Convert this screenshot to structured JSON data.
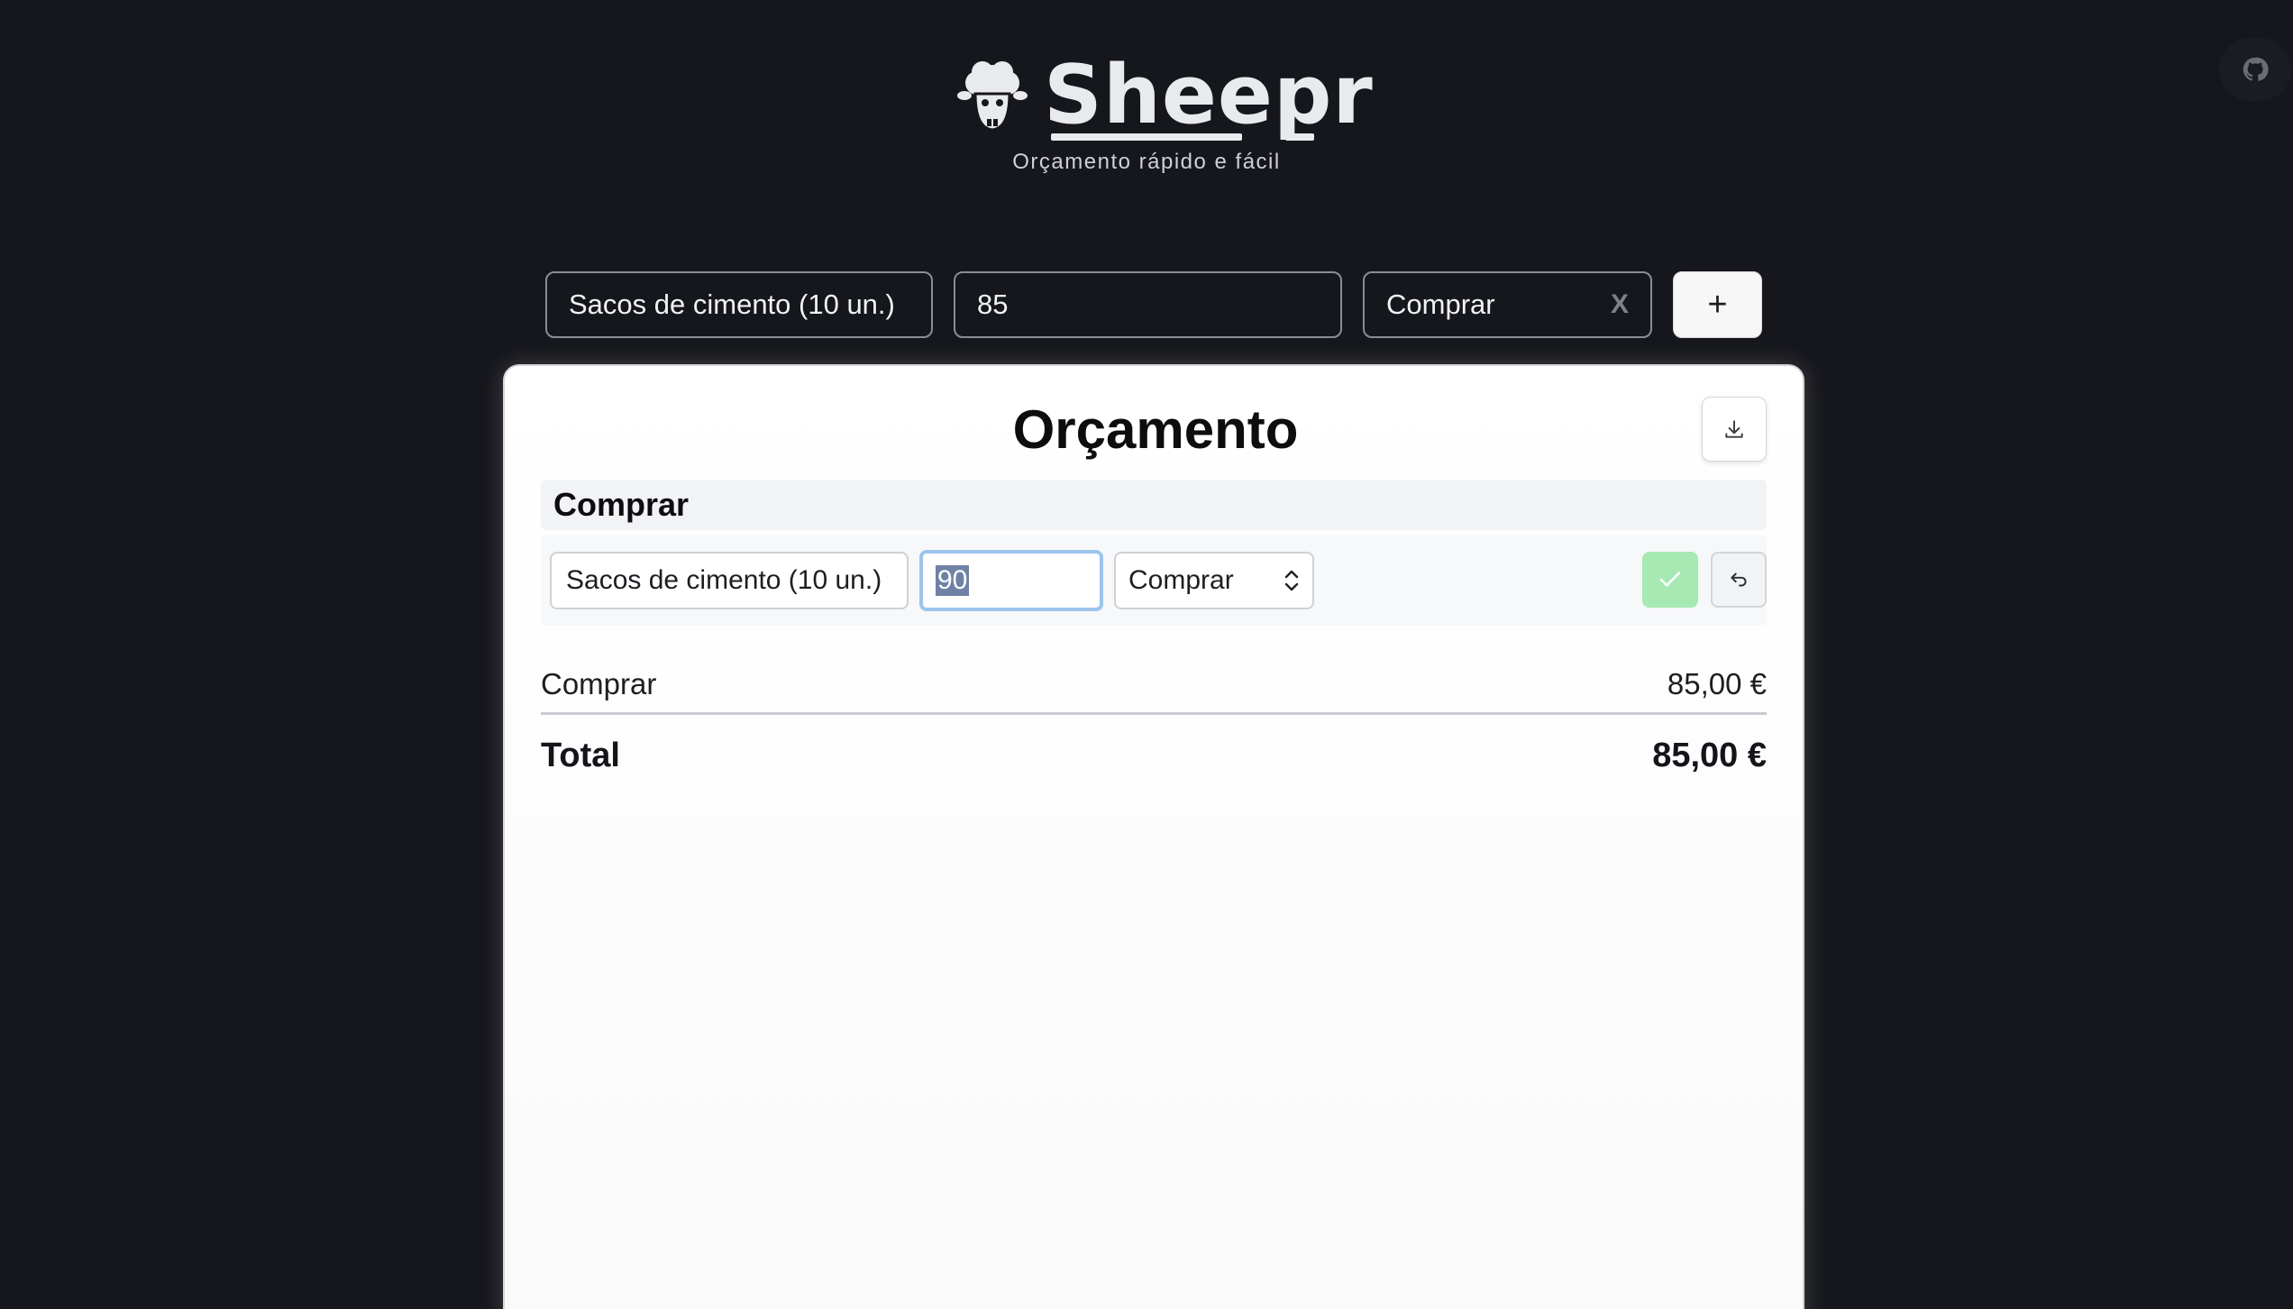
{
  "header": {
    "brand": "Sheepr",
    "tagline": "Orçamento rápido e fácil",
    "github_icon": "github-icon"
  },
  "form": {
    "name_value": "Sacos de cimento (10 un.)",
    "price_value": "85",
    "category_value": "Comprar",
    "clear_label": "X",
    "add_label": "+"
  },
  "card": {
    "title": "Orçamento",
    "download_icon": "download-icon",
    "section_title": "Comprar",
    "edit_row": {
      "name_value": "Sacos de cimento (10 un.)",
      "price_value": "90",
      "category_value": "Comprar",
      "confirm_icon": "check-icon",
      "cancel_icon": "undo-icon"
    },
    "summary": [
      {
        "label": "Comprar",
        "amount": "85,00 €"
      }
    ],
    "total": {
      "label": "Total",
      "amount": "85,00 €"
    }
  },
  "colors": {
    "background": "#16171c",
    "confirm": "#a6e9b2",
    "focus_ring": "#9cc4ec",
    "selection": "#6f82a6"
  }
}
